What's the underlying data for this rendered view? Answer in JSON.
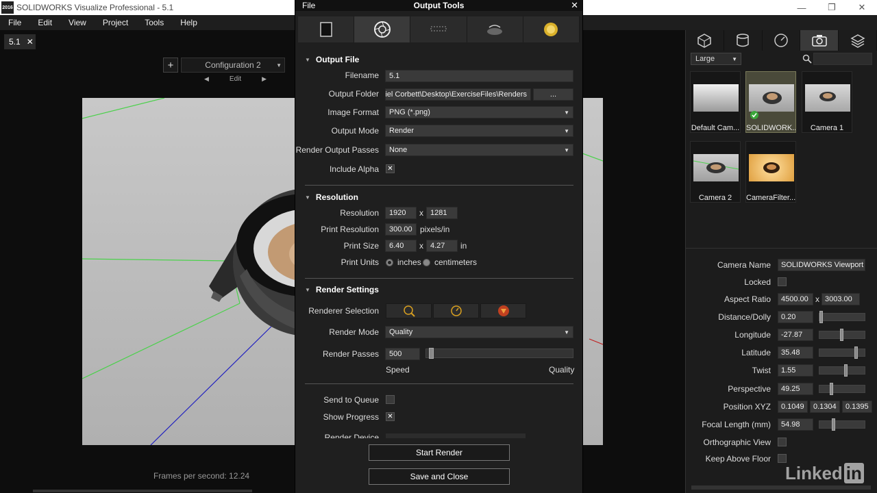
{
  "window": {
    "title": "SOLIDWORKS Visualize Professional - 5.1",
    "app_badge": "2016",
    "controls": [
      "—",
      "❐",
      "✕"
    ]
  },
  "menubar": [
    "File",
    "Edit",
    "View",
    "Project",
    "Tools",
    "Help"
  ],
  "document_tab": {
    "label": "5.1",
    "close": "✕"
  },
  "viewport": {
    "add_label": "+",
    "configuration": "Configuration 2",
    "edit_label": "Edit",
    "fps": "Frames per second: 12.24"
  },
  "dialog": {
    "menu": "File",
    "title": "Output Tools",
    "close": "✕",
    "tabs": [
      "render-image",
      "aperture",
      "animation",
      "turntable",
      "sun-study"
    ],
    "output_file": {
      "heading": "Output File",
      "filename_label": "Filename",
      "filename": "5.1",
      "folder_label": "Output Folder",
      "folder": "Gabriel Corbett\\Desktop\\ExerciseFiles\\Renders",
      "browse": "...",
      "format_label": "Image Format",
      "format": "PNG (*.png)",
      "mode_label": "Output Mode",
      "mode": "Render",
      "passes_label": "Render Output Passes",
      "passes": "None",
      "alpha_label": "Include Alpha",
      "alpha_mark": "✕"
    },
    "resolution": {
      "heading": "Resolution",
      "res_label": "Resolution",
      "width": "1920",
      "x": "x",
      "height": "1281",
      "print_res_label": "Print Resolution",
      "print_res": "300.00",
      "print_res_unit": "pixels/in",
      "print_size_label": "Print Size",
      "print_w": "6.40",
      "print_h": "4.27",
      "print_size_unit": "in",
      "units_label": "Print Units",
      "unit_inches": "inches",
      "unit_cm": "centimeters"
    },
    "render_settings": {
      "heading": "Render Settings",
      "renderer_label": "Renderer Selection",
      "mode_label": "Render Mode",
      "mode": "Quality",
      "passes_label": "Render Passes",
      "passes": "500",
      "passes_fraction": 0.02,
      "speed": "Speed",
      "quality": "Quality"
    },
    "queue_label": "Send to Queue",
    "progress_label": "Show Progress",
    "progress_mark": "✕",
    "device_label": "Render Device",
    "start_render": "Start Render",
    "save_close": "Save and Close"
  },
  "right_panel": {
    "size": "Large",
    "cameras": [
      {
        "label": "Default Cam..."
      },
      {
        "label": "SOLIDWORK..."
      },
      {
        "label": "Camera 1"
      },
      {
        "label": "Camera 2"
      },
      {
        "label": "CameraFilter..."
      }
    ],
    "props": {
      "camera_name_label": "Camera Name",
      "camera_name": "SOLIDWORKS Viewport",
      "locked_label": "Locked",
      "aspect_label": "Aspect Ratio",
      "aspect_w": "4500.00",
      "aspect_x": "x",
      "aspect_h": "3003.00",
      "distance_label": "Distance/Dolly",
      "distance": "0.20",
      "longitude_label": "Longitude",
      "longitude": "-27.87",
      "latitude_label": "Latitude",
      "latitude": "35.48",
      "twist_label": "Twist",
      "twist": "1.55",
      "perspective_label": "Perspective",
      "perspective": "49.25",
      "position_label": "Position XYZ",
      "pos_x": "0.1049",
      "pos_y": "0.1304",
      "pos_z": "0.1395",
      "focal_label": "Focal Length (mm)",
      "focal": "54.98",
      "ortho_label": "Orthographic View",
      "floor_label": "Keep Above Floor"
    }
  },
  "watermark": {
    "linked": "Linked",
    "in": "in"
  },
  "colors": {
    "accent_green": "#4bd14b",
    "dialog_bg": "#1f1f1f",
    "panel_bg": "#1c1c1c"
  }
}
